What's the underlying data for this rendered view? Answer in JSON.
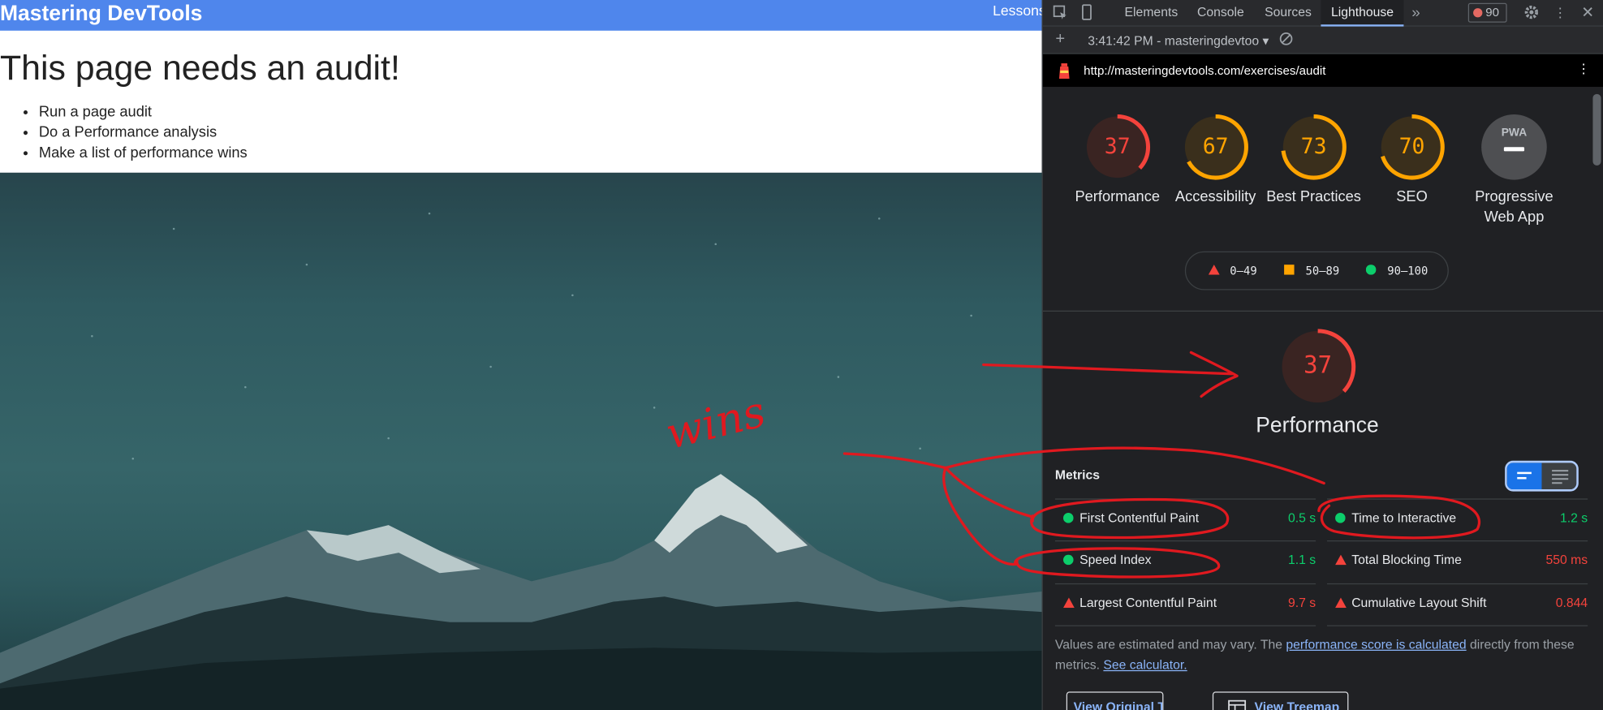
{
  "page": {
    "site_title": "Mastering DevTools",
    "nav_lessons": "Lessons",
    "heading": "This page needs an audit!",
    "todo": [
      "Run a page audit",
      "Do a Performance analysis",
      "Make a list of performance wins"
    ]
  },
  "devtools": {
    "tabs": [
      "Elements",
      "Console",
      "Sources",
      "Lighthouse"
    ],
    "active_tab": "Lighthouse",
    "more_tabs_icon": "chevron-double-right-icon",
    "error_count": "90",
    "report_select": "3:41:42 PM - masteringdevtoo",
    "url": "http://masteringdevtools.com/exercises/audit",
    "categories": [
      {
        "label": "Performance",
        "score": "37",
        "score_value": 37,
        "color": "#f4433c"
      },
      {
        "label": "Accessibility",
        "score": "67",
        "score_value": 67,
        "color": "#ffa400"
      },
      {
        "label": "Best Practices",
        "score": "73",
        "score_value": 73,
        "color": "#ffa400"
      },
      {
        "label": "SEO",
        "score": "70",
        "score_value": 70,
        "color": "#ffa400"
      },
      {
        "label": "Progressive Web App",
        "badge": "PWA"
      }
    ],
    "legend": {
      "fail": "0–49",
      "average": "50–89",
      "pass": "90–100"
    },
    "performance": {
      "score": "37",
      "title": "Performance",
      "metrics_title": "Metrics",
      "metrics": [
        {
          "name": "First Contentful Paint",
          "value": "0.5 s",
          "status": "pass"
        },
        {
          "name": "Time to Interactive",
          "value": "1.2 s",
          "status": "pass"
        },
        {
          "name": "Speed Index",
          "value": "1.1 s",
          "status": "pass"
        },
        {
          "name": "Total Blocking Time",
          "value": "550 ms",
          "status": "fail"
        },
        {
          "name": "Largest Contentful Paint",
          "value": "9.7 s",
          "status": "fail"
        },
        {
          "name": "Cumulative Layout Shift",
          "value": "0.844",
          "status": "fail"
        }
      ],
      "note_prefix": "Values are estimated and may vary. The ",
      "note_link": "performance score is calculated",
      "note_middle": " directly from these metrics. ",
      "note_calc": "See calculator.",
      "buttons": [
        "View Original Trace",
        "View Treemap"
      ]
    },
    "colors": {
      "pass": "#0cce6b",
      "average": "#ffa400",
      "fail": "#f4433c"
    }
  },
  "annotation": {
    "text": "wins",
    "color": "#e0191f"
  }
}
